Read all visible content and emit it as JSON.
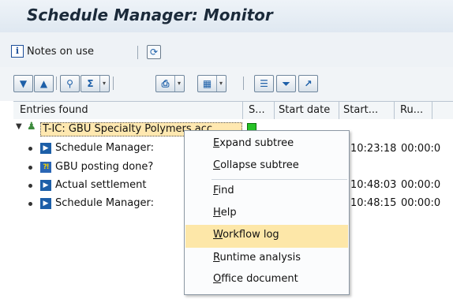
{
  "title": "Schedule Manager: Monitor",
  "appbar": {
    "notes_label": "Notes on use"
  },
  "icons": {
    "info": "info-icon",
    "refresh": "refresh-icon",
    "triangle_down": "triangle-down-icon",
    "triangle_up": "triangle-up-icon",
    "binoculars": "binoculars-icon",
    "sum": "sum-icon",
    "print": "print-icon",
    "layout": "layout-icon",
    "filter": "filter-icon",
    "detail": "detail-icon"
  },
  "grid": {
    "headers": [
      "Entries found",
      "S...",
      "Start date",
      "Start...",
      "Ru..."
    ],
    "root_label": "T-IC: GBU Specialty Polymers acc",
    "rows": [
      {
        "label": "Schedule Manager:",
        "start_time": "10:23:18",
        "runtime": "00:00:0",
        "icon": "step"
      },
      {
        "label": "GBU posting done?",
        "start_time": "",
        "runtime": "",
        "icon": "question"
      },
      {
        "label": "Actual settlement",
        "start_time": "10:48:03",
        "runtime": "00:00:0",
        "icon": "step"
      },
      {
        "label": "Schedule Manager:",
        "start_time": "10:48:15",
        "runtime": "00:00:0",
        "icon": "step"
      }
    ]
  },
  "context_menu": {
    "items": [
      {
        "pre": "",
        "ul": "E",
        "post": "xpand subtree"
      },
      {
        "pre": "",
        "ul": "C",
        "post": "ollapse subtree"
      },
      {
        "pre": "",
        "ul": "F",
        "post": "ind"
      },
      {
        "pre": "",
        "ul": "H",
        "post": "elp"
      },
      {
        "pre": "",
        "ul": "W",
        "post": "orkflow log",
        "highlighted": true
      },
      {
        "pre": "",
        "ul": "R",
        "post": "untime analysis"
      },
      {
        "pre": "",
        "ul": "O",
        "post": "ffice document"
      }
    ]
  },
  "colors": {
    "highlight": "#fde7a8",
    "status_green": "#27c227",
    "title_text": "#1b2a3a"
  }
}
